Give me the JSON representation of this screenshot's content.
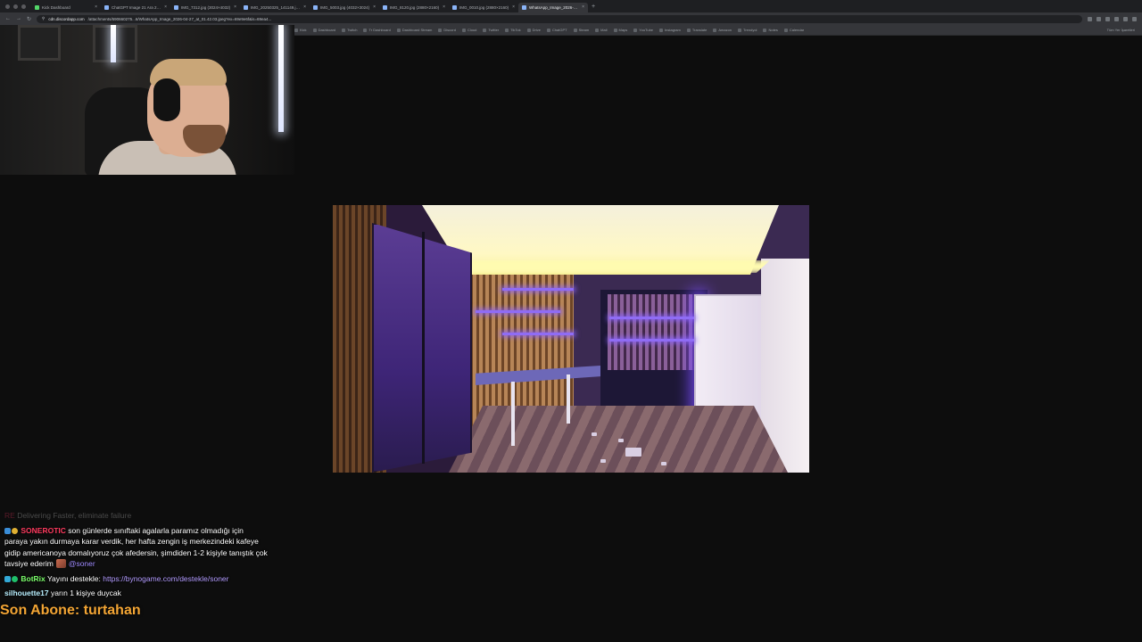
{
  "browser": {
    "tabs": [
      {
        "title": "Kick Dashboard",
        "favicon": "kick-icon",
        "active": false
      },
      {
        "title": "ChatGPT Image 21 Ara 20...",
        "favicon": "chatgpt-icon",
        "active": false
      },
      {
        "title": "IMG_7312.jpg (3024×4032)",
        "favicon": "image-icon",
        "active": false
      },
      {
        "title": "IMG_20250325_141149.jp...",
        "favicon": "image-icon",
        "active": false
      },
      {
        "title": "IMG_5003.jpg (4032×3024)",
        "favicon": "image-icon",
        "active": false
      },
      {
        "title": "IMG_8120.jpg (2880×2160)",
        "favicon": "image-icon",
        "active": false
      },
      {
        "title": "IMG_0010.jpg (2880×2160)",
        "favicon": "image-icon",
        "active": false
      },
      {
        "title": "WhatsApp_Image_2026-04...",
        "favicon": "image-icon",
        "active": true
      }
    ],
    "url_host": "cdn.discordapp.com",
    "url_path": "/attachments/690660275...6/WhatsApp_Image_2026-04-27_at_01.42.03.jpeg?ex=69e9e6f&is=69ea4...",
    "bookmarks": [
      "Kick",
      "Dashboard",
      "Twitch",
      "Tr Dashboard",
      "Dashboard Stream",
      "Discord",
      "Cloud",
      "Twitter",
      "TikTok",
      "Drive",
      "ChatGPT",
      "Steam",
      "Mail",
      "Maps",
      "YouTube",
      "Instagram",
      "Translate",
      "Amazon",
      "Trendyol",
      "Notes",
      "Calendar"
    ],
    "bookmarks_end": "Tüm Yer İşaretleri"
  },
  "chat": {
    "faded_user": "RE",
    "faded_text": "Delivering Faster, eliminate failure",
    "messages": [
      {
        "badges": [
          "blue",
          "gold"
        ],
        "username": "SONEROTIC",
        "text": "son günlerde sınıftaki agalarla paramız olmadığı için paraya yakın durmaya karar verdik, her hafta zengin iş merkezindeki kafeye gidip americanoya domalıyoruz çok afedersin, şimdiden 1-2 kişiyle tanıştık çok tavsiye ederim",
        "mention": "@soner"
      },
      {
        "badges": [
          "cyan",
          "green"
        ],
        "username": "BotRix",
        "text": "Yayını destekle:",
        "link": "https://bynogame.com/destekle/soner"
      },
      {
        "badges": [],
        "username": "silhouette17",
        "text": "yarın 1 kişiye duycak"
      }
    ]
  },
  "last_sub": "Son Abone: turtahan"
}
